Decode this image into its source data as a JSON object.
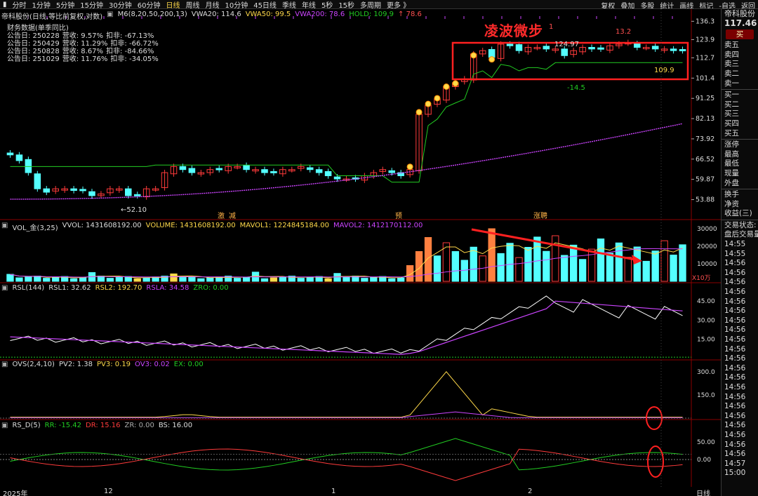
{
  "toolbar": {
    "periods": [
      "分时",
      "1分钟",
      "5分钟",
      "15分钟",
      "30分钟",
      "60分钟",
      "日线",
      "周线",
      "月线",
      "10分钟",
      "45日线",
      "季线",
      "年线",
      "5秒",
      "15秒",
      "多周期",
      "更多 》"
    ],
    "active_period": "日线",
    "right_items": [
      "复权",
      "叠加",
      "多股",
      "统计",
      "画线",
      "标记",
      "-自选",
      "返回"
    ]
  },
  "main_panel": {
    "title": "帝科股份(日线,等比前复权,对数)",
    "indicator_name": "M6(8,20,50,200,13)",
    "vwa20": "VWA20: 114.6",
    "vwa50": "VWA50: 99.5",
    "vwa200": "VWA200: 78.6",
    "hold": "HOLD: 109.9",
    "hold2": "↑ 78.6",
    "fin_title": "财务数据(单季同比)",
    "fin_rows": [
      {
        "date": "公告日: 250228",
        "rev": "营收: 9.57%",
        "kf": "扣非: -67.13%"
      },
      {
        "date": "公告日: 250429",
        "rev": "营收: 11.29%",
        "kf": "扣非: -66.72%"
      },
      {
        "date": "公告日: 250828",
        "rev": "营收: 8.67%",
        "kf": "扣非: -84.66%"
      },
      {
        "date": "公告日: 251029",
        "rev": "营收: 11.76%",
        "kf": "扣非: -34.05%"
      }
    ],
    "annotation_title": "凌波微步",
    "labels": {
      "low": "←52.10",
      "high": "124.97",
      "diff": "-14.5",
      "hold_val": "109.9",
      "peak_val": "13.2",
      "one": "1"
    },
    "y_ticks": [
      "136.3",
      "123.9",
      "112.7",
      "101.4",
      "91.25",
      "82.13",
      "73.92",
      "66.52",
      "59.87",
      "53.88"
    ],
    "markers": [
      "激",
      "减",
      "预",
      "涨聘"
    ]
  },
  "vol_panel": {
    "title": "VOL_金(3,25)",
    "vvol": "VVOL: 1431608192.00",
    "volume": "VOLUME: 1431608192.00",
    "mavol1": "MAVOL1: 1224845184.00",
    "mavol2": "MAVOL2: 1412170112.00",
    "y_ticks": [
      "30000",
      "20000",
      "10000"
    ],
    "unit": "X10万"
  },
  "rsl_panel": {
    "title": "RSL(144)",
    "rsl1": "RSL1: 32.62",
    "rsl2": "RSL2: 192.70",
    "rsla": "RSLA: 34.58",
    "zro": "ZRO: 0.00",
    "y_ticks": [
      "45.00",
      "30.00",
      "15.00"
    ]
  },
  "ovs_panel": {
    "title": "OVS(2,4,10)",
    "pv2": "PV2: 1.38",
    "pv3": "PV3: 0.19",
    "ov3": "OV3: 0.02",
    "ex": "EX: 0.00",
    "y_ticks": [
      "300.0",
      "150.0"
    ]
  },
  "rsd_panel": {
    "title": "RS_D(5)",
    "rr": "RR: -15.42",
    "dr": "DR: 15.16",
    "zr": "ZR: 0.00",
    "bs": "BS: 16.00",
    "y_ticks": [
      "50.00",
      "0.00"
    ]
  },
  "x_axis": {
    "labels": [
      "2025年",
      "12",
      "1",
      "2"
    ],
    "right_label": "日线"
  },
  "right_panel": {
    "stock_name": "帝科股份",
    "price": "117.46",
    "buy": "买",
    "sell_rows": [
      "卖五",
      "卖四",
      "卖三",
      "卖二",
      "卖一"
    ],
    "buy_rows": [
      "买一",
      "买二",
      "买三",
      "买四",
      "买五"
    ],
    "info_rows": [
      "涨停",
      "最高",
      "最低",
      "现量",
      "外盘"
    ],
    "info_rows2": [
      "换手",
      "净资",
      "收益(三)"
    ],
    "trade_rows": [
      "交易状态:",
      "盘后交易量"
    ],
    "times": [
      "14:55",
      "14:55",
      "14:56",
      "14:56",
      "14:56",
      "14:56",
      "14:56",
      "14:56",
      "14:56",
      "14:56",
      "14:56",
      "14:56",
      "14:56",
      "14:56",
      "14:56",
      "14:56",
      "14:56",
      "14:56",
      "14:56",
      "14:56",
      "14:56",
      "14:56",
      "14:56",
      "14:57",
      "15:00"
    ]
  },
  "colors": {
    "up": "#ff3b3b",
    "down": "#54ffff",
    "ma_green": "#22cc22",
    "ma_purple": "#cc44ff",
    "yellow": "#ffd94a",
    "orange": "#ff8040"
  }
}
